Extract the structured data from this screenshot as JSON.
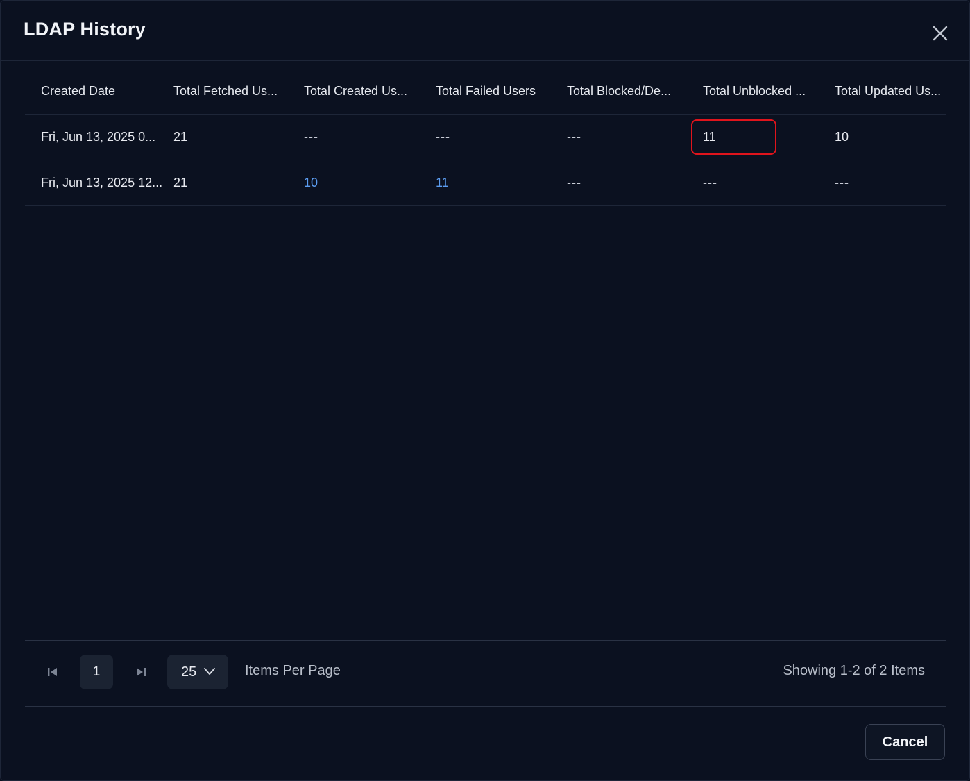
{
  "dialog": {
    "title": "LDAP History",
    "close_icon": "close-icon"
  },
  "table": {
    "columns": [
      "Created Date",
      "Total Fetched Us...",
      "Total Created Us...",
      "Total Failed Users",
      "Total Blocked/De...",
      "Total Unblocked ...",
      "Total Updated Us..."
    ],
    "rows": [
      {
        "created_date": "Fri, Jun 13, 2025 0...",
        "fetched": "21",
        "created": "---",
        "failed": "---",
        "blocked": "---",
        "unblocked": "11",
        "updated": "10"
      },
      {
        "created_date": "Fri, Jun 13, 2025 12...",
        "fetched": "21",
        "created": "10",
        "failed": "11",
        "blocked": "---",
        "unblocked": "---",
        "updated": "---"
      }
    ]
  },
  "pagination": {
    "first_page_icon": "first-page-icon",
    "last_page_icon": "last-page-icon",
    "current_page": "1",
    "items_per_page": "25",
    "items_per_page_label": "Items Per Page",
    "showing_text": "Showing 1-2 of 2 Items"
  },
  "actions": {
    "cancel_label": "Cancel"
  },
  "colors": {
    "background": "#0b1120",
    "link": "#5b9cf0",
    "highlight": "#e0141c"
  }
}
